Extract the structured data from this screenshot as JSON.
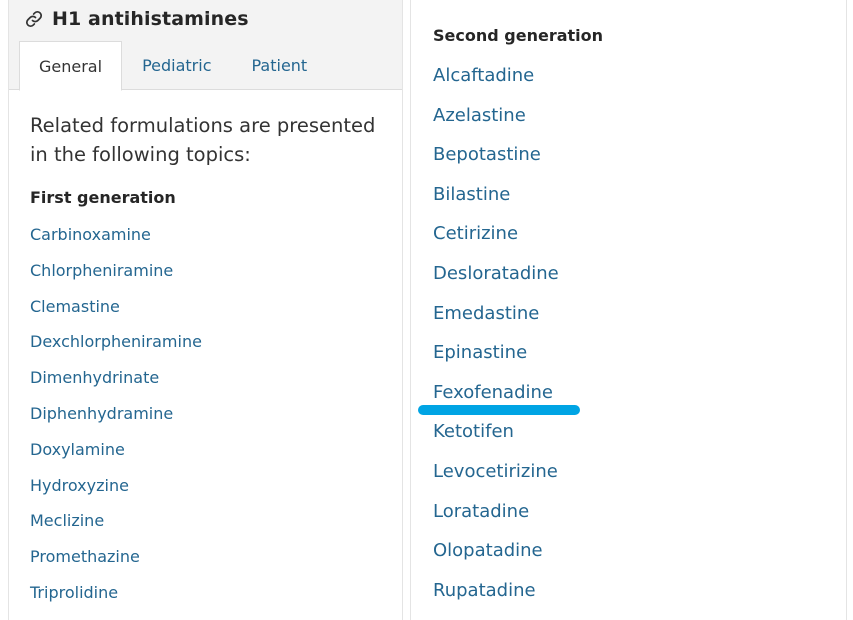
{
  "header": {
    "title": "H1 antihistamines",
    "icon": "link-icon"
  },
  "tabs": [
    {
      "label": "General",
      "active": true
    },
    {
      "label": "Pediatric",
      "active": false
    },
    {
      "label": "Patient",
      "active": false
    }
  ],
  "left": {
    "intro": "Related formulations are presented in the following topics:",
    "heading": "First generation",
    "items": [
      "Carbinoxamine",
      "Chlorpheniramine",
      "Clemastine",
      "Dexchlorpheniramine",
      "Dimenhydrinate",
      "Diphenhydramine",
      "Doxylamine",
      "Hydroxyzine",
      "Meclizine",
      "Promethazine",
      "Triprolidine"
    ]
  },
  "right": {
    "heading": "Second generation",
    "items": [
      "Alcaftadine",
      "Azelastine",
      "Bepotastine",
      "Bilastine",
      "Cetirizine",
      "Desloratadine",
      "Emedastine",
      "Epinastine",
      "Fexofenadine",
      "Ketotifen",
      "Levocetirizine",
      "Loratadine",
      "Olopatadine",
      "Rupatadine"
    ]
  },
  "colors": {
    "link": "#246690",
    "highlight": "#00a4e4",
    "heading": "#262626",
    "header_background": "#f3f3f3"
  }
}
